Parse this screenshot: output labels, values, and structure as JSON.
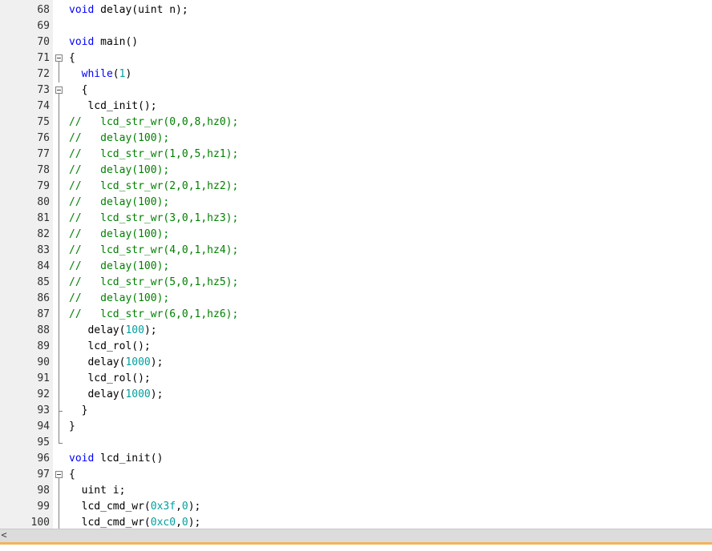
{
  "editor": {
    "lines": [
      {
        "n": "68",
        "tokens": [
          [
            "k",
            "void"
          ],
          [
            "p",
            " delay(uint n);"
          ]
        ]
      },
      {
        "n": "69",
        "tokens": []
      },
      {
        "n": "70",
        "tokens": [
          [
            "k",
            "void"
          ],
          [
            "p",
            " main()"
          ]
        ]
      },
      {
        "n": "71",
        "tokens": [
          [
            "p",
            "{"
          ]
        ],
        "fold": "box"
      },
      {
        "n": "72",
        "tokens": [
          [
            "p",
            "  "
          ],
          [
            "k",
            "while"
          ],
          [
            "p",
            "("
          ],
          [
            "n",
            "1"
          ],
          [
            "p",
            ")"
          ]
        ],
        "fold": "bar"
      },
      {
        "n": "73",
        "tokens": [
          [
            "p",
            "  {"
          ]
        ],
        "fold": "box"
      },
      {
        "n": "74",
        "tokens": [
          [
            "p",
            "   lcd_init();"
          ]
        ],
        "fold": "bar"
      },
      {
        "n": "75",
        "tokens": [
          [
            "c",
            "//   lcd_str_wr(0,0,8,hz0);"
          ]
        ],
        "fold": "bar"
      },
      {
        "n": "76",
        "tokens": [
          [
            "c",
            "//   delay(100);"
          ]
        ],
        "fold": "bar"
      },
      {
        "n": "77",
        "tokens": [
          [
            "c",
            "//   lcd_str_wr(1,0,5,hz1);"
          ]
        ],
        "fold": "bar"
      },
      {
        "n": "78",
        "tokens": [
          [
            "c",
            "//   delay(100);"
          ]
        ],
        "fold": "bar"
      },
      {
        "n": "79",
        "tokens": [
          [
            "c",
            "//   lcd_str_wr(2,0,1,hz2);"
          ]
        ],
        "fold": "bar"
      },
      {
        "n": "80",
        "tokens": [
          [
            "c",
            "//   delay(100);"
          ]
        ],
        "fold": "bar"
      },
      {
        "n": "81",
        "tokens": [
          [
            "c",
            "//   lcd_str_wr(3,0,1,hz3);"
          ]
        ],
        "fold": "bar"
      },
      {
        "n": "82",
        "tokens": [
          [
            "c",
            "//   delay(100);"
          ]
        ],
        "fold": "bar"
      },
      {
        "n": "83",
        "tokens": [
          [
            "c",
            "//   lcd_str_wr(4,0,1,hz4);"
          ]
        ],
        "fold": "bar"
      },
      {
        "n": "84",
        "tokens": [
          [
            "c",
            "//   delay(100);"
          ]
        ],
        "fold": "bar"
      },
      {
        "n": "85",
        "tokens": [
          [
            "c",
            "//   lcd_str_wr(5,0,1,hz5);"
          ]
        ],
        "fold": "bar"
      },
      {
        "n": "86",
        "tokens": [
          [
            "c",
            "//   delay(100);"
          ]
        ],
        "fold": "bar"
      },
      {
        "n": "87",
        "tokens": [
          [
            "c",
            "//   lcd_str_wr(6,0,1,hz6);"
          ]
        ],
        "fold": "bar"
      },
      {
        "n": "88",
        "tokens": [
          [
            "p",
            "   delay("
          ],
          [
            "n",
            "100"
          ],
          [
            "p",
            ");"
          ]
        ],
        "fold": "bar"
      },
      {
        "n": "89",
        "tokens": [
          [
            "p",
            "   lcd_rol();"
          ]
        ],
        "fold": "bar"
      },
      {
        "n": "90",
        "tokens": [
          [
            "p",
            "   delay("
          ],
          [
            "n",
            "1000"
          ],
          [
            "p",
            ");"
          ]
        ],
        "fold": "bar"
      },
      {
        "n": "91",
        "tokens": [
          [
            "p",
            "   lcd_rol();"
          ]
        ],
        "fold": "bar"
      },
      {
        "n": "92",
        "tokens": [
          [
            "p",
            "   delay("
          ],
          [
            "n",
            "1000"
          ],
          [
            "p",
            ");"
          ]
        ],
        "fold": "bar"
      },
      {
        "n": "93",
        "tokens": [
          [
            "p",
            "  }"
          ]
        ],
        "fold": "tee"
      },
      {
        "n": "94",
        "tokens": [
          [
            "p",
            "}"
          ]
        ],
        "fold": "bar"
      },
      {
        "n": "95",
        "tokens": [],
        "fold": "end"
      },
      {
        "n": "96",
        "tokens": [
          [
            "k",
            "void"
          ],
          [
            "p",
            " lcd_init()"
          ]
        ]
      },
      {
        "n": "97",
        "tokens": [
          [
            "p",
            "{"
          ]
        ],
        "fold": "box"
      },
      {
        "n": "98",
        "tokens": [
          [
            "p",
            "  uint i;"
          ]
        ],
        "fold": "bar"
      },
      {
        "n": "99",
        "tokens": [
          [
            "p",
            "  lcd_cmd_wr("
          ],
          [
            "n",
            "0x3f"
          ],
          [
            "p",
            ","
          ],
          [
            "n",
            "0"
          ],
          [
            "p",
            ");"
          ]
        ],
        "fold": "bar"
      },
      {
        "n": "100",
        "tokens": [
          [
            "p",
            "  lcd_cmd_wr("
          ],
          [
            "n",
            "0xc0"
          ],
          [
            "p",
            ","
          ],
          [
            "n",
            "0"
          ],
          [
            "p",
            ");"
          ]
        ],
        "fold": "bar"
      }
    ]
  },
  "scrollbar": {
    "left_arrow": "<"
  },
  "colors": {
    "keyword": "#0000ff",
    "number": "#00a0a0",
    "comment": "#008000",
    "gutter_bg": "#f0f0f0",
    "status_accent": "#f2b45a"
  }
}
